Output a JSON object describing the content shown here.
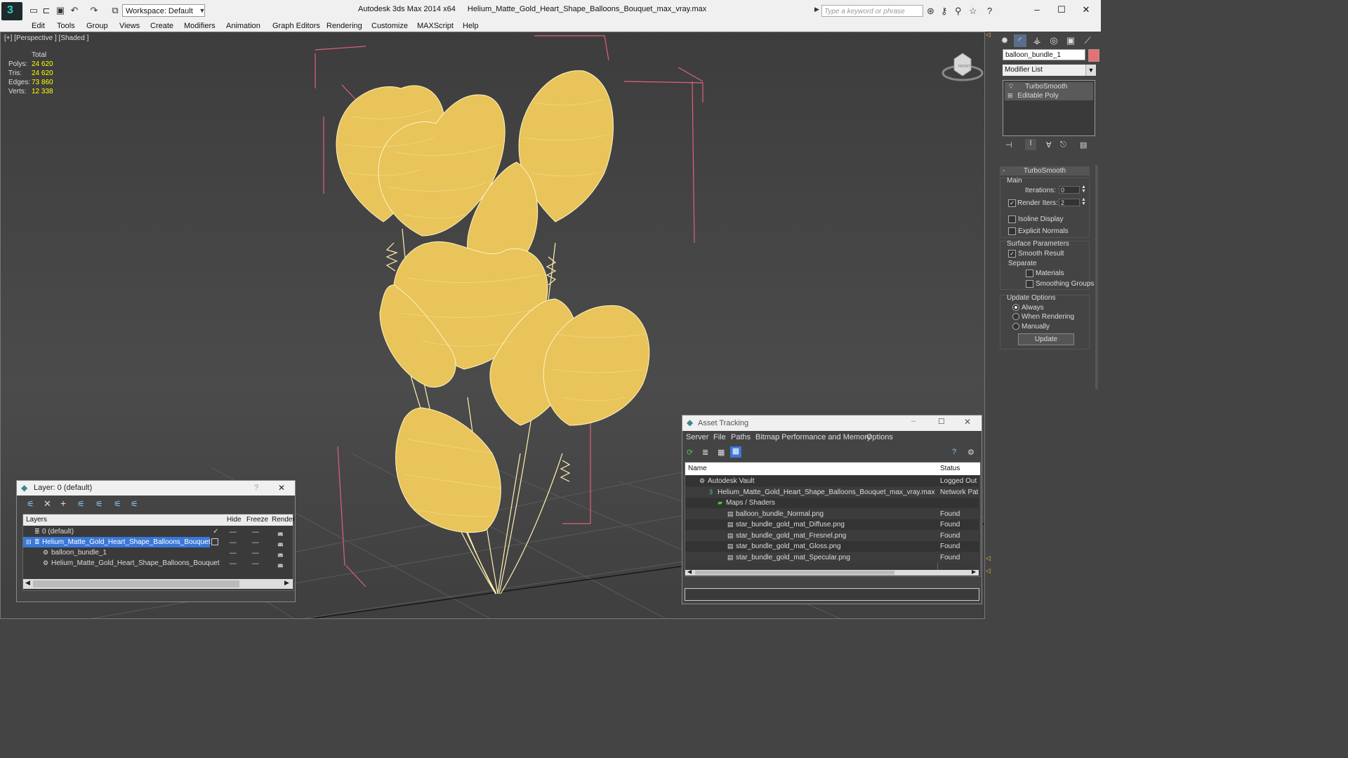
{
  "titlebar": {
    "workspace": "Workspace: Default",
    "app": "Autodesk 3ds Max  2014 x64",
    "file": "Helium_Matte_Gold_Heart_Shape_Balloons_Bouquet_max_vray.max",
    "search_placeholder": "Type a keyword or phrase",
    "min": "–",
    "max": "☐",
    "close": "✕"
  },
  "menu": [
    "Edit",
    "Tools",
    "Group",
    "Views",
    "Create",
    "Modifiers",
    "Animation",
    "Graph Editors",
    "Rendering",
    "Customize",
    "MAXScript",
    "Help"
  ],
  "viewport": {
    "label": "[+] [Perspective ] [Shaded ]",
    "stats": {
      "header": "Total",
      "rows": [
        {
          "label": "Polys:",
          "value": "24 620"
        },
        {
          "label": "Tris:",
          "value": "24 620"
        },
        {
          "label": "Edges:",
          "value": "73 860"
        },
        {
          "label": "Verts:",
          "value": "12 338"
        }
      ]
    },
    "viewcube_label": "FRONT"
  },
  "command_panel": {
    "object_name": "balloon_bundle_1",
    "modifier_list": "Modifier List",
    "stack": [
      "TurboSmooth",
      "Editable Poly"
    ],
    "rollout_title": "TurboSmooth",
    "main_label": "Main",
    "iterations_label": "Iterations:",
    "iterations_value": "0",
    "render_iters_label": "Render Iters:",
    "render_iters_value": "2",
    "isoline": "Isoline Display",
    "explicit": "Explicit Normals",
    "surface_label": "Surface Parameters",
    "smooth_result": "Smooth Result",
    "separate_label": "Separate",
    "materials": "Materials",
    "smoothing_groups": "Smoothing Groups",
    "update_options": "Update Options",
    "always": "Always",
    "when_rendering": "When Rendering",
    "manually": "Manually",
    "update_btn": "Update"
  },
  "layer_dialog": {
    "title": "Layer: 0 (default)",
    "help": "?",
    "close": "✕",
    "headers": {
      "layers": "Layers",
      "hide": "Hide",
      "freeze": "Freeze",
      "render": "Render"
    },
    "rows": [
      {
        "name": "0 (default)",
        "indent": 0,
        "selected": false
      },
      {
        "name": "Helium_Matte_Gold_Heart_Shape_Balloons_Bouquet",
        "indent": 0,
        "selected": true
      },
      {
        "name": "balloon_bundle_1",
        "indent": 1,
        "selected": false
      },
      {
        "name": "Helium_Matte_Gold_Heart_Shape_Balloons_Bouquet",
        "indent": 1,
        "selected": false
      }
    ]
  },
  "asset_dialog": {
    "title": "Asset Tracking",
    "menu": [
      "Server",
      "File",
      "Paths",
      "Bitmap Performance and Memory",
      "Options"
    ],
    "col_name": "Name",
    "col_status": "Status",
    "rows": [
      {
        "name": "Autodesk Vault",
        "status": "Logged Out",
        "indent": 1
      },
      {
        "name": "Helium_Matte_Gold_Heart_Shape_Balloons_Bouquet_max_vray.max",
        "status": "Network Pat",
        "indent": 2
      },
      {
        "name": "Maps / Shaders",
        "status": "",
        "indent": 3
      },
      {
        "name": "balloon_bundle_Normal.png",
        "status": "Found",
        "indent": 4
      },
      {
        "name": "star_bundle_gold_mat_Diffuse.png",
        "status": "Found",
        "indent": 4
      },
      {
        "name": "star_bundle_gold_mat_Fresnel.png",
        "status": "Found",
        "indent": 4
      },
      {
        "name": "star_bundle_gold_mat_Gloss.png",
        "status": "Found",
        "indent": 4
      },
      {
        "name": "star_bundle_gold_mat_Specular.png",
        "status": "Found",
        "indent": 4
      }
    ]
  },
  "colors": {
    "balloon": "#e8c45a",
    "wire": "#fff4c0",
    "bbox": "#e0607a",
    "selection": "#3a78d8"
  }
}
